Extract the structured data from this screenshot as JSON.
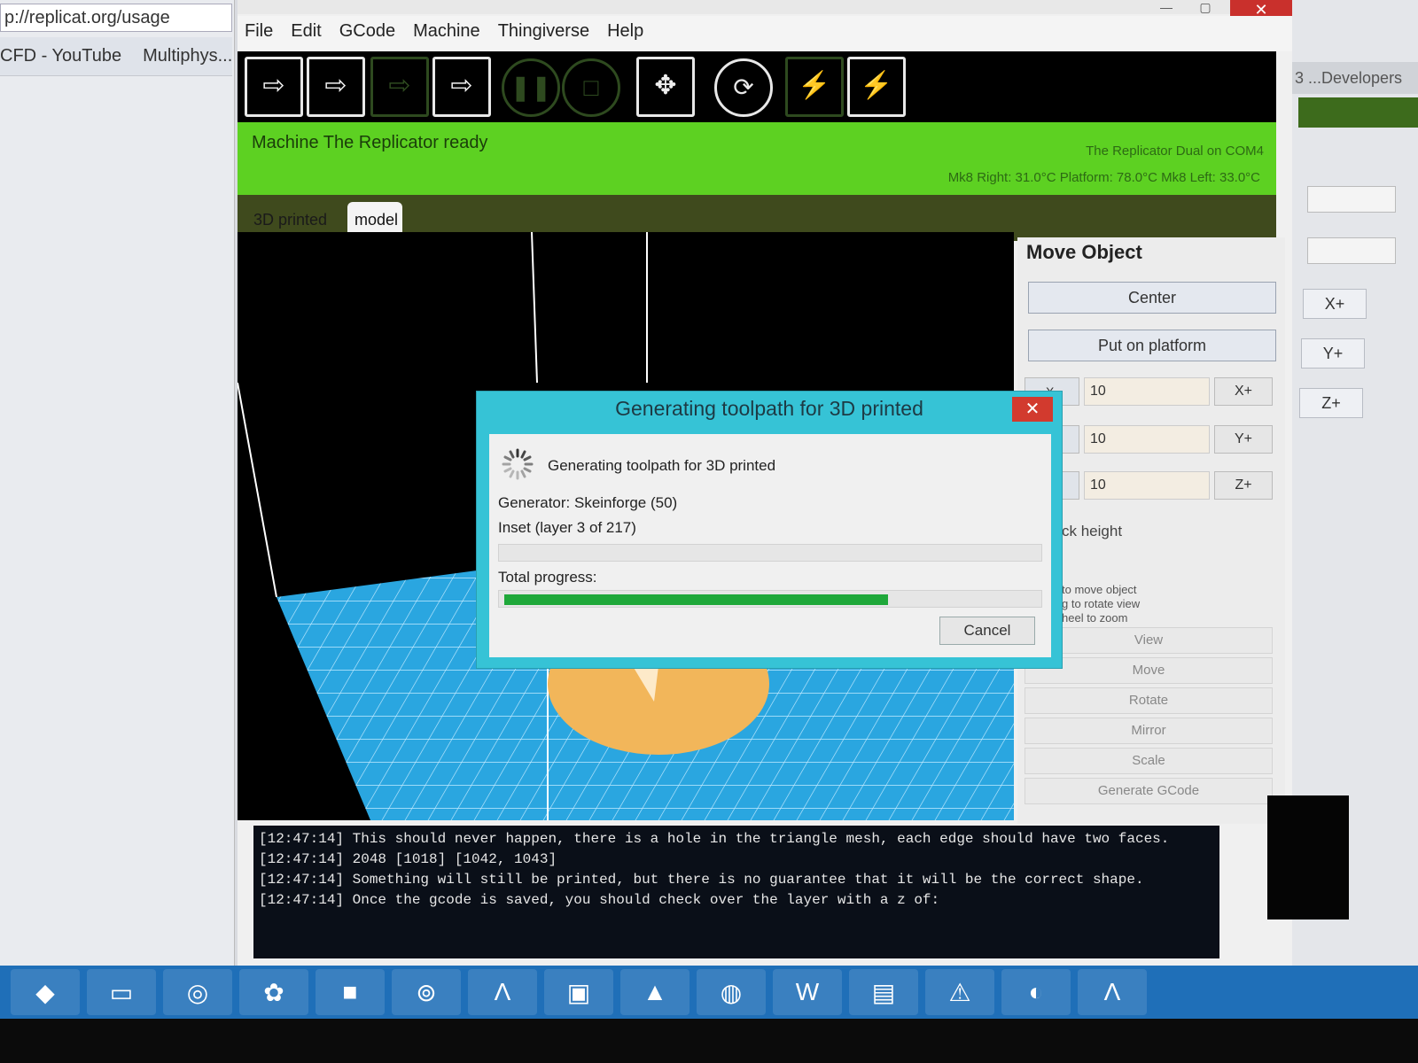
{
  "browser": {
    "url": "p://replicat.org/usage",
    "bookmarks": [
      "CFD - YouTube",
      "Multiphys..."
    ]
  },
  "right_window": {
    "title_fragment": "3 ...Developers"
  },
  "app": {
    "menu": [
      "File",
      "Edit",
      "GCode",
      "Machine",
      "Thingiverse",
      "Help"
    ],
    "status": {
      "message": "Machine The Replicator ready",
      "port": "The Replicator Dual on COM4",
      "temps": "Mk8 Right: 31.0°C  Platform: 78.0°C Mk8 Left: 33.0°C"
    },
    "tabs": [
      "3D printed",
      "model"
    ],
    "panel": {
      "title": "Move Object",
      "center": "Center",
      "put_on_platform": "Put on platform",
      "fields": [
        {
          "value": "10",
          "axis": "X+"
        },
        {
          "value": "10",
          "axis": "Y+"
        },
        {
          "value": "10",
          "axis": "Z+"
        }
      ],
      "lock_height": "ck height",
      "hints": [
        "to move object",
        "g to rotate view",
        "heel to zoom"
      ],
      "modes": [
        "View",
        "Move",
        "Rotate",
        "Mirror",
        "Scale",
        "Generate GCode"
      ],
      "side_axes": [
        "X+",
        "Y+",
        "Z+"
      ]
    },
    "console": [
      "[12:47:14] This should never happen, there is a hole in the triangle mesh, each edge should have two faces.",
      "[12:47:14] 2048 [1018] [1042, 1043]",
      "[12:47:14] Something will still be printed, but there is no guarantee that it will be the correct shape.",
      "[12:47:14] Once the gcode is saved, you should check over the layer with a z of:"
    ]
  },
  "dialog": {
    "title": "Generating toolpath for 3D printed",
    "message": "Generating toolpath for 3D printed",
    "generator": "Generator: Skeinforge (50)",
    "layer": "Inset (layer 3 of 217)",
    "layer_progress": 0.0,
    "total_label": "Total progress:",
    "total_progress": 0.72,
    "cancel": "Cancel"
  },
  "colors": {
    "status_green": "#5dd122",
    "dialog_cyan": "#36c3d6",
    "platform_blue": "#2aa6e0",
    "progress_green": "#1fa83a"
  },
  "icons": {
    "toolbar": [
      "import-icon",
      "export-icon",
      "build-to-file-icon",
      "build-icon",
      "pause-icon",
      "stop-icon",
      "move-icon",
      "reset-icon",
      "connect-icon",
      "disconnect-icon"
    ]
  }
}
